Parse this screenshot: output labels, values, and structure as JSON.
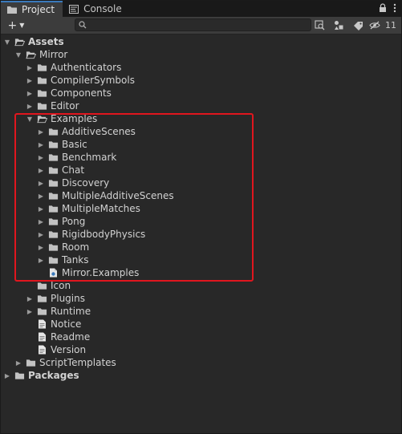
{
  "tabs": [
    {
      "label": "Project",
      "icon": "folder-icon",
      "active": true
    },
    {
      "label": "Console",
      "icon": "console-icon",
      "active": false
    }
  ],
  "toolbar": {
    "add_label": "+",
    "search_placeholder": "",
    "hidden_count": "11"
  },
  "tree": {
    "assets": "Assets",
    "mirror": "Mirror",
    "authenticators": "Authenticators",
    "compiler_symbols": "CompilerSymbols",
    "components": "Components",
    "editor": "Editor",
    "examples": "Examples",
    "additive_scenes": "AdditiveScenes",
    "basic": "Basic",
    "benchmark": "Benchmark",
    "chat": "Chat",
    "discovery": "Discovery",
    "multiple_additive_scenes": "MultipleAdditiveScenes",
    "multiple_matches": "MultipleMatches",
    "pong": "Pong",
    "rigidbody_physics": "RigidbodyPhysics",
    "room": "Room",
    "tanks": "Tanks",
    "mirror_examples": "Mirror.Examples",
    "icon": "Icon",
    "plugins": "Plugins",
    "runtime": "Runtime",
    "notice": "Notice",
    "readme": "Readme",
    "version": "Version",
    "script_templates": "ScriptTemplates",
    "packages": "Packages"
  },
  "colors": {
    "accent": "#3a79bb",
    "highlight_box": "#e0161e",
    "folder": "#c2c2c2"
  }
}
